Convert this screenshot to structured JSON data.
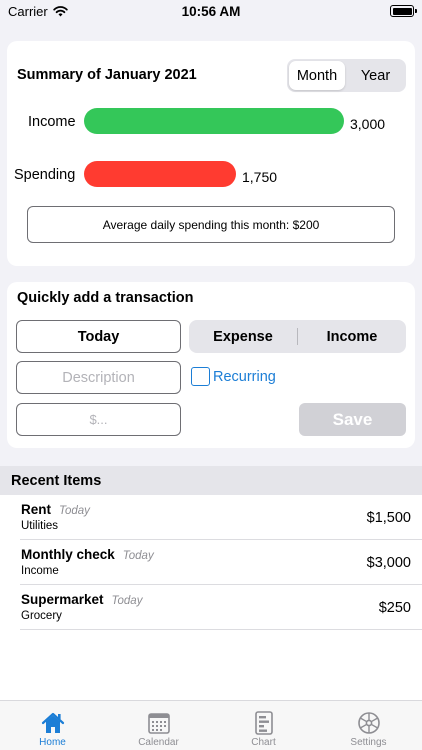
{
  "status_bar": {
    "carrier": "Carrier",
    "time": "10:56 AM"
  },
  "summary": {
    "title": "Summary of January 2021",
    "period_options": [
      "Month",
      "Year"
    ],
    "selected_period": "Month",
    "income_label": "Income",
    "income_value": "3,000",
    "income_color": "#34c759",
    "spending_label": "Spending",
    "spending_value": "1,750",
    "spending_color": "#ff3b30",
    "average_text": "Average daily spending this month: $200"
  },
  "quick_add": {
    "title": "Quickly add a transaction",
    "date_label": "Today",
    "type_options": [
      "Expense",
      "Income"
    ],
    "description_placeholder": "Description",
    "recurring_label": "Recurring",
    "amount_placeholder": "$...",
    "save_label": "Save"
  },
  "recent": {
    "header": "Recent Items",
    "items": [
      {
        "name": "Rent",
        "when": "Today",
        "category": "Utilities",
        "amount": "$1,500"
      },
      {
        "name": "Monthly check",
        "when": "Today",
        "category": "Income",
        "amount": "$3,000"
      },
      {
        "name": "Supermarket",
        "when": "Today",
        "category": "Grocery",
        "amount": "$250"
      }
    ]
  },
  "tabs": [
    {
      "label": "Home",
      "icon": "house-icon",
      "active": true
    },
    {
      "label": "Calendar",
      "icon": "calendar-icon",
      "active": false
    },
    {
      "label": "Chart",
      "icon": "chart-icon",
      "active": false
    },
    {
      "label": "Settings",
      "icon": "gear-icon",
      "active": false
    }
  ],
  "colors": {
    "accent": "#1c7ed6",
    "background": "#f2f2f7"
  }
}
